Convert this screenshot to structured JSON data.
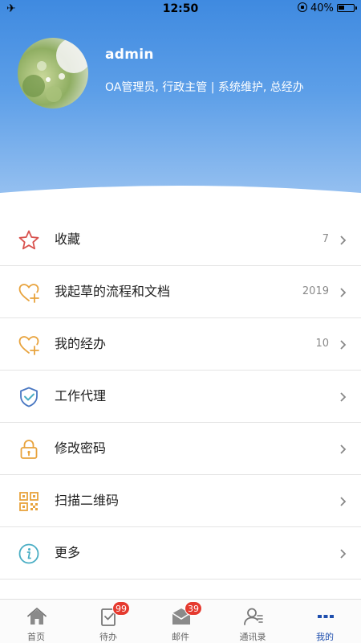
{
  "status_bar": {
    "time": "12:50",
    "battery": "40%"
  },
  "profile": {
    "username": "admin",
    "roles": "OA管理员, 行政主管 | 系统维护, 总经办"
  },
  "menu": [
    {
      "label": "收藏",
      "count": "7",
      "icon": "star-icon"
    },
    {
      "label": "我起草的流程和文档",
      "count": "2019",
      "icon": "heart-plus-icon"
    },
    {
      "label": "我的经办",
      "count": "10",
      "icon": "heart-plus-icon"
    },
    {
      "label": "工作代理",
      "count": "",
      "icon": "shield-check-icon"
    },
    {
      "label": "修改密码",
      "count": "",
      "icon": "lock-icon"
    },
    {
      "label": "扫描二维码",
      "count": "",
      "icon": "qrcode-icon"
    },
    {
      "label": "更多",
      "count": "",
      "icon": "info-icon"
    }
  ],
  "tabs": [
    {
      "label": "首页",
      "icon": "home-icon",
      "badge": ""
    },
    {
      "label": "待办",
      "icon": "todo-checklist-icon",
      "badge": "99"
    },
    {
      "label": "邮件",
      "icon": "mail-icon",
      "badge": "39"
    },
    {
      "label": "通讯录",
      "icon": "contacts-icon",
      "badge": ""
    },
    {
      "label": "我的",
      "icon": "more-dots-icon",
      "badge": "",
      "active": true
    }
  ],
  "colors": {
    "header_blue": "#3f8ae0",
    "badge_red": "#e53a2f",
    "active_tab": "#1f4fae",
    "icon_orange": "#e8a33d",
    "icon_red": "#d9534f",
    "icon_blue": "#4a78c2",
    "icon_teal": "#4aaec4"
  }
}
